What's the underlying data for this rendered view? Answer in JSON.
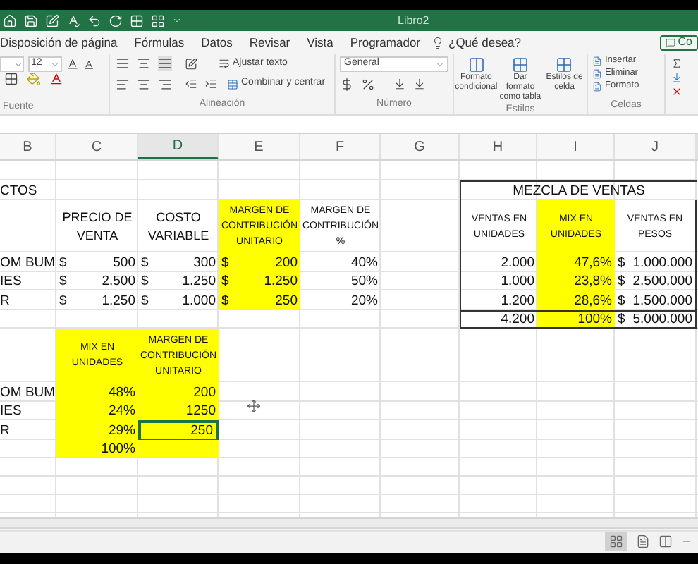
{
  "title_bar": {
    "title": "Libro2"
  },
  "ribbon_tabs": [
    {
      "label": "Disposición de página",
      "selected": false
    },
    {
      "label": "Fórmulas",
      "selected": false
    },
    {
      "label": "Datos",
      "selected": false
    },
    {
      "label": "Revisar",
      "selected": false
    },
    {
      "label": "Vista",
      "selected": false
    },
    {
      "label": "Programador",
      "selected": false
    }
  ],
  "tell_me": {
    "label": "¿Qué desea?"
  },
  "share_button": {
    "label": "Co"
  },
  "ribbon": {
    "font": {
      "size": "12",
      "group_label": "Fuente"
    },
    "alignment": {
      "wrap_text": "Ajustar texto",
      "merge": "Combinar y centrar",
      "group_label": "Alineación"
    },
    "number": {
      "format": "General",
      "group_label": "Número"
    },
    "styles": {
      "buttons": [
        "Formato condicional",
        "Dar formato como tabla",
        "Estilos de celda"
      ],
      "group_label": "Estilos"
    },
    "cells": {
      "buttons": [
        "Insertar",
        "Eliminar",
        "Formato"
      ],
      "group_label": "Celdas"
    }
  },
  "sheet": {
    "columns": [
      {
        "label": "B",
        "selected": false
      },
      {
        "label": "C",
        "selected": false
      },
      {
        "label": "D",
        "selected": true
      },
      {
        "label": "E",
        "selected": false
      },
      {
        "label": "F",
        "selected": false
      },
      {
        "label": "G",
        "selected": false
      },
      {
        "label": "H",
        "selected": false
      },
      {
        "label": "I",
        "selected": false
      },
      {
        "label": "J",
        "selected": false
      }
    ],
    "rows": [
      [
        {
          "highlighted": false,
          "selected": false
        },
        {
          "highlighted": false,
          "selected": false
        },
        {
          "highlighted": false,
          "selected": false
        },
        {
          "highlighted": false,
          "selected": false
        },
        {
          "highlighted": false,
          "selected": false
        },
        {
          "highlighted": false,
          "selected": false
        },
        {
          "highlighted": false,
          "selected": false
        },
        {
          "highlighted": false,
          "selected": false
        },
        {
          "highlighted": false,
          "selected": false
        }
      ],
      [
        {
          "kind": "label",
          "text": "CTOS",
          "highlighted": false,
          "selected": false
        },
        {
          "highlighted": false,
          "selected": false
        },
        {
          "highlighted": false,
          "selected": false
        },
        {
          "highlighted": false,
          "selected": false
        },
        {
          "highlighted": false,
          "selected": false
        },
        {
          "highlighted": false,
          "selected": false
        },
        {
          "kind": "merged_title",
          "text": "MEZCLA DE VENTAS",
          "highlighted": false,
          "selected": false
        }
      ],
      [
        {
          "highlighted": false,
          "selected": false
        },
        {
          "kind": "header",
          "text": "PRECIO DE VENTA",
          "highlighted": false,
          "selected": false
        },
        {
          "kind": "header",
          "text": "COSTO VARIABLE",
          "highlighted": false,
          "selected": false
        },
        {
          "kind": "small_header",
          "text": "MARGEN DE CONTRIBUCIÓN UNITARIO",
          "highlighted": true,
          "selected": false
        },
        {
          "kind": "small_header",
          "text": "MARGEN DE CONTRIBUCIÓN %",
          "highlighted": false,
          "selected": false
        },
        {
          "highlighted": false,
          "selected": false
        },
        {
          "kind": "small_header",
          "text": "VENTAS EN UNIDADES",
          "highlighted": false,
          "selected": false
        },
        {
          "kind": "small_header",
          "text": "MIX EN UNIDADES",
          "highlighted": true,
          "selected": false
        },
        {
          "kind": "small_header",
          "text": "VENTAS EN PESOS",
          "highlighted": false,
          "selected": false
        }
      ],
      [
        {
          "kind": "label",
          "text": "OM BUM",
          "highlighted": false,
          "selected": false
        },
        {
          "kind": "currency",
          "symbol": "$",
          "text": "500",
          "highlighted": false,
          "selected": false
        },
        {
          "kind": "currency",
          "symbol": "$",
          "text": "300",
          "highlighted": false,
          "selected": false
        },
        {
          "kind": "currency",
          "symbol": "$",
          "text": "200",
          "highlighted": true,
          "selected": false
        },
        {
          "kind": "number",
          "text": "40%",
          "highlighted": false,
          "selected": false
        },
        {
          "highlighted": false,
          "selected": false
        },
        {
          "kind": "number",
          "text": "2.000",
          "highlighted": false,
          "selected": false
        },
        {
          "kind": "number",
          "text": "47,6%",
          "highlighted": true,
          "selected": false
        },
        {
          "kind": "currency",
          "symbol": "$",
          "text": "1.000.000",
          "highlighted": false,
          "selected": false
        }
      ],
      [
        {
          "kind": "label",
          "text": "IES",
          "highlighted": false,
          "selected": false
        },
        {
          "kind": "currency",
          "symbol": "$",
          "text": "2.500",
          "highlighted": false,
          "selected": false
        },
        {
          "kind": "currency",
          "symbol": "$",
          "text": "1.250",
          "highlighted": false,
          "selected": false
        },
        {
          "kind": "currency",
          "symbol": "$",
          "text": "1.250",
          "highlighted": true,
          "selected": false
        },
        {
          "kind": "number",
          "text": "50%",
          "highlighted": false,
          "selected": false
        },
        {
          "highlighted": false,
          "selected": false
        },
        {
          "kind": "number",
          "text": "1.000",
          "highlighted": false,
          "selected": false
        },
        {
          "kind": "number",
          "text": "23,8%",
          "highlighted": true,
          "selected": false
        },
        {
          "kind": "currency",
          "symbol": "$",
          "text": "2.500.000",
          "highlighted": false,
          "selected": false
        }
      ],
      [
        {
          "kind": "label",
          "text": "R",
          "highlighted": false,
          "selected": false
        },
        {
          "kind": "currency",
          "symbol": "$",
          "text": "1.250",
          "highlighted": false,
          "selected": false
        },
        {
          "kind": "currency",
          "symbol": "$",
          "text": "1.000",
          "highlighted": false,
          "selected": false
        },
        {
          "kind": "currency",
          "symbol": "$",
          "text": "250",
          "highlighted": true,
          "selected": false
        },
        {
          "kind": "number",
          "text": "20%",
          "highlighted": false,
          "selected": false
        },
        {
          "highlighted": false,
          "selected": false
        },
        {
          "kind": "number",
          "text": "1.200",
          "highlighted": false,
          "selected": false
        },
        {
          "kind": "number",
          "text": "28,6%",
          "highlighted": true,
          "selected": false
        },
        {
          "kind": "currency",
          "symbol": "$",
          "text": "1.500.000",
          "highlighted": false,
          "selected": false
        }
      ],
      [
        {
          "highlighted": false,
          "selected": false
        },
        {
          "highlighted": false,
          "selected": false
        },
        {
          "highlighted": false,
          "selected": false
        },
        {
          "highlighted": false,
          "selected": false
        },
        {
          "highlighted": false,
          "selected": false
        },
        {
          "highlighted": false,
          "selected": false
        },
        {
          "kind": "number",
          "text": "4.200",
          "highlighted": false,
          "selected": false
        },
        {
          "kind": "number",
          "text": "100%",
          "highlighted": true,
          "selected": false
        },
        {
          "kind": "currency",
          "symbol": "$",
          "text": "5.000.000",
          "highlighted": false,
          "selected": false
        }
      ],
      [
        {
          "highlighted": false,
          "selected": false
        },
        {
          "kind": "small_header",
          "text": "MIX EN UNIDADES",
          "highlighted": true,
          "selected": false
        },
        {
          "kind": "small_header",
          "text": "MARGEN DE CONTRIBUCIÓN UNITARIO",
          "highlighted": true,
          "selected": false
        },
        {
          "highlighted": false,
          "selected": false
        },
        {
          "highlighted": false,
          "selected": false
        },
        {
          "highlighted": false,
          "selected": false
        },
        {
          "highlighted": false,
          "selected": false
        },
        {
          "highlighted": false,
          "selected": false
        },
        {
          "highlighted": false,
          "selected": false
        }
      ],
      [
        {
          "kind": "label",
          "text": "OM BUM",
          "highlighted": false,
          "selected": false
        },
        {
          "kind": "number",
          "text": "48%",
          "highlighted": true,
          "selected": false
        },
        {
          "kind": "number",
          "text": "200",
          "highlighted": true,
          "selected": false
        },
        {
          "highlighted": false,
          "selected": false
        },
        {
          "highlighted": false,
          "selected": false
        },
        {
          "highlighted": false,
          "selected": false
        },
        {
          "highlighted": false,
          "selected": false
        },
        {
          "highlighted": false,
          "selected": false
        },
        {
          "highlighted": false,
          "selected": false
        }
      ],
      [
        {
          "kind": "label",
          "text": "IES",
          "highlighted": false,
          "selected": false
        },
        {
          "kind": "number",
          "text": "24%",
          "highlighted": true,
          "selected": false
        },
        {
          "kind": "number",
          "text": "1250",
          "highlighted": true,
          "selected": false
        },
        {
          "highlighted": false,
          "selected": false
        },
        {
          "highlighted": false,
          "selected": false
        },
        {
          "highlighted": false,
          "selected": false
        },
        {
          "highlighted": false,
          "selected": false
        },
        {
          "highlighted": false,
          "selected": false
        },
        {
          "highlighted": false,
          "selected": false
        }
      ],
      [
        {
          "kind": "label",
          "text": "R",
          "highlighted": false,
          "selected": false
        },
        {
          "kind": "number",
          "text": "29%",
          "highlighted": true,
          "selected": false
        },
        {
          "kind": "number",
          "text": "250",
          "highlighted": true,
          "selected": true
        },
        {
          "highlighted": false,
          "selected": false
        },
        {
          "highlighted": false,
          "selected": false
        },
        {
          "highlighted": false,
          "selected": false
        },
        {
          "highlighted": false,
          "selected": false
        },
        {
          "highlighted": false,
          "selected": false
        },
        {
          "highlighted": false,
          "selected": false
        }
      ],
      [
        {
          "highlighted": false,
          "selected": false
        },
        {
          "kind": "number",
          "text": "100%",
          "highlighted": true,
          "selected": false
        },
        {
          "highlighted": true,
          "selected": false
        },
        {
          "highlighted": false,
          "selected": false
        },
        {
          "highlighted": false,
          "selected": false
        },
        {
          "highlighted": false,
          "selected": false
        },
        {
          "highlighted": false,
          "selected": false
        },
        {
          "highlighted": false,
          "selected": false
        },
        {
          "highlighted": false,
          "selected": false
        }
      ]
    ]
  }
}
